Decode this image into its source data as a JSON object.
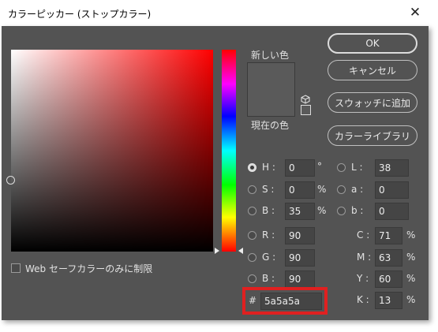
{
  "window": {
    "title": "カラーピッカー (ストップカラー)",
    "close_glyph": "✕"
  },
  "colors": {
    "current": "#5a5a5a",
    "highlight": "#e02020",
    "field_bg": "#535353",
    "hue_accent": "#ff0000"
  },
  "preview": {
    "new_label": "新しい色",
    "current_label": "現在の色"
  },
  "buttons": {
    "ok": "OK",
    "cancel": "キャンセル",
    "add_swatch": "スウォッチに追加",
    "libraries": "カラーライブラリ"
  },
  "web_safe": {
    "label": "Web セーフカラーのみに制限",
    "checked": false
  },
  "hsb": {
    "h": {
      "label": "H :",
      "value": "0",
      "unit": "°",
      "selected": true
    },
    "s": {
      "label": "S :",
      "value": "0",
      "unit": "%",
      "selected": false
    },
    "b": {
      "label": "B :",
      "value": "35",
      "unit": "%",
      "selected": false
    }
  },
  "lab": {
    "l": {
      "label": "L :",
      "value": "38"
    },
    "a": {
      "label": "a :",
      "value": "0"
    },
    "b": {
      "label": "b :",
      "value": "0"
    }
  },
  "rgb": {
    "r": {
      "label": "R :",
      "value": "90"
    },
    "g": {
      "label": "G :",
      "value": "90"
    },
    "b": {
      "label": "B :",
      "value": "90"
    }
  },
  "cmyk": {
    "c": {
      "label": "C :",
      "value": "71",
      "unit": "%"
    },
    "m": {
      "label": "M :",
      "value": "63",
      "unit": "%"
    },
    "y": {
      "label": "Y :",
      "value": "60",
      "unit": "%"
    },
    "k": {
      "label": "K :",
      "value": "13",
      "unit": "%"
    }
  },
  "hex": {
    "label": "#",
    "value": "5a5a5a"
  }
}
